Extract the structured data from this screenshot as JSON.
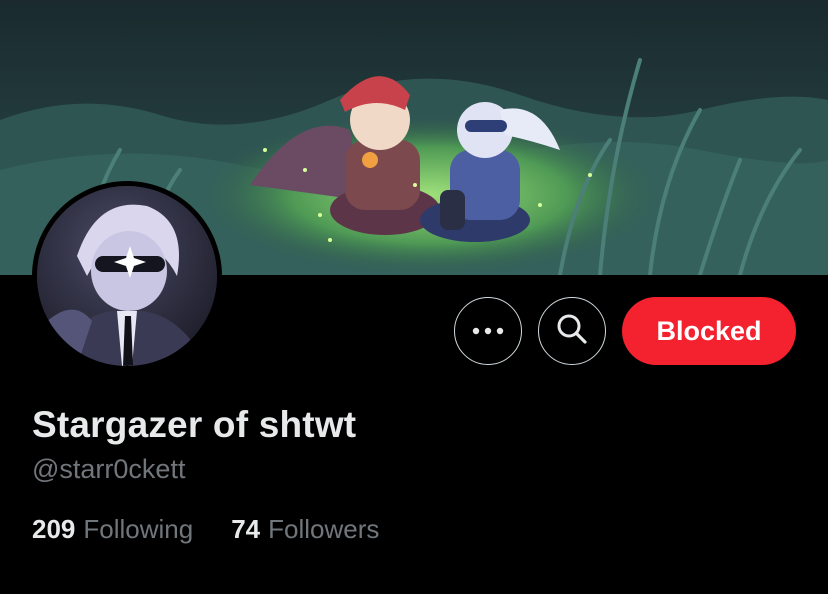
{
  "profile": {
    "display_name": "Stargazer of shtwt",
    "handle": "@starr0ckett",
    "following_count": "209",
    "following_label": "Following",
    "followers_count": "74",
    "followers_label": "Followers"
  },
  "actions": {
    "more_icon": "more-dots-icon",
    "search_icon": "search-icon",
    "blocked_label": "Blocked"
  },
  "colors": {
    "background": "#000000",
    "blocked_button": "#f4212e",
    "primary_text": "#e7e9ea",
    "secondary_text": "#71767b"
  }
}
